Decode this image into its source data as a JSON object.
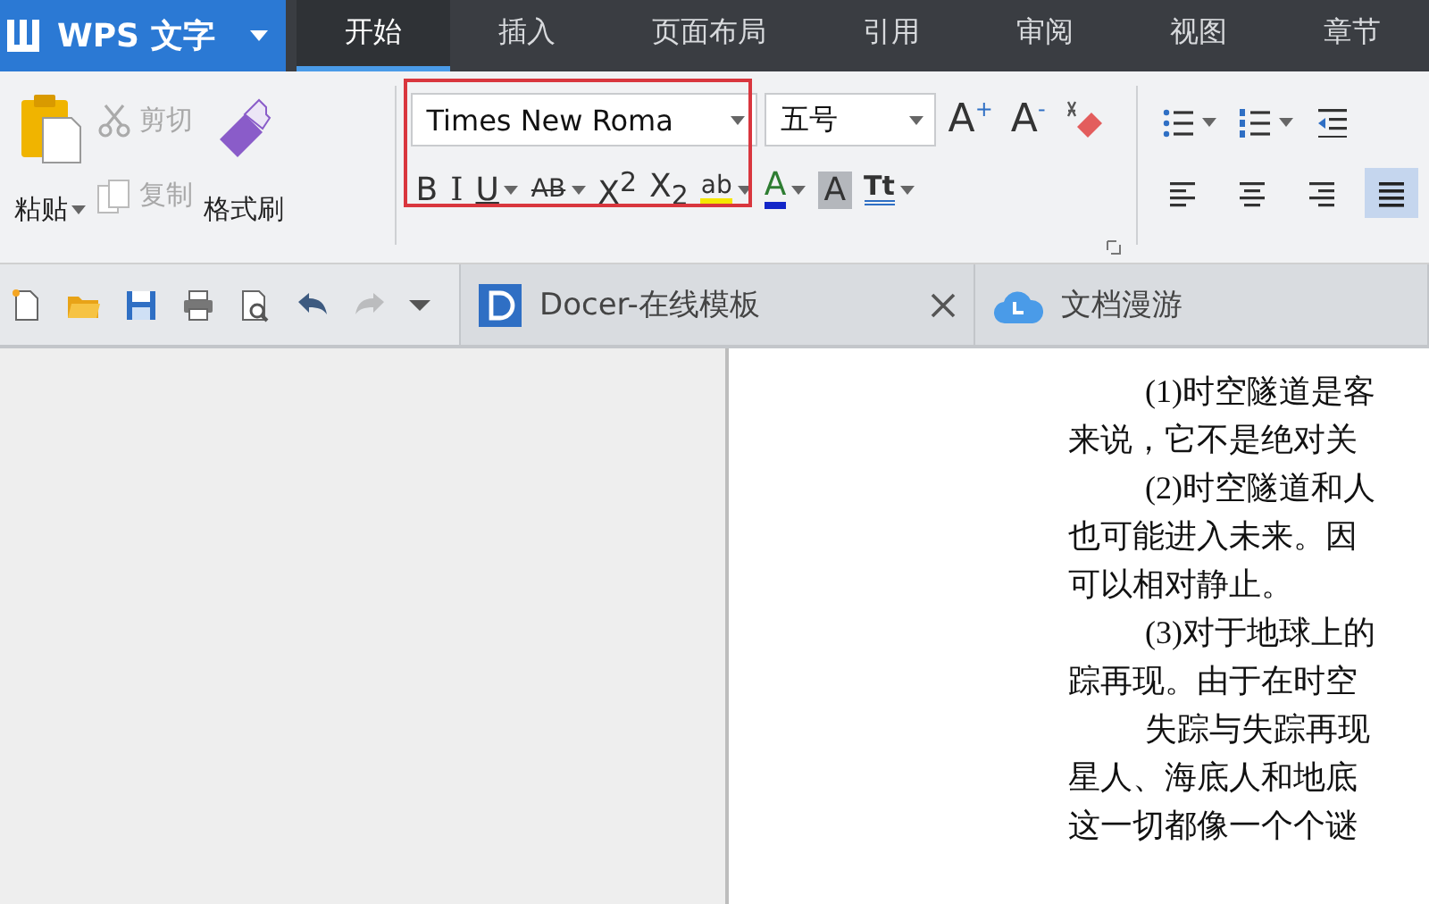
{
  "app_menu": {
    "title": "WPS 文字"
  },
  "menu_tabs": [
    {
      "label": "开始",
      "selected": true
    },
    {
      "label": "插入",
      "selected": false
    },
    {
      "label": "页面布局",
      "selected": false
    },
    {
      "label": "引用",
      "selected": false
    },
    {
      "label": "审阅",
      "selected": false
    },
    {
      "label": "视图",
      "selected": false
    },
    {
      "label": "章节",
      "selected": false
    }
  ],
  "clipboard": {
    "paste": "粘贴",
    "cut": {
      "label": "剪切",
      "disabled": true
    },
    "copy": {
      "label": "复制",
      "disabled": true
    },
    "format_painter": "格式刷"
  },
  "font": {
    "name": "Times New Roma",
    "size": "五号",
    "annotated": true,
    "row1": [
      {
        "kind": "grow",
        "label": "A$^{+}$"
      },
      {
        "kind": "shrink",
        "label": "A$^{-}$"
      },
      {
        "kind": "clear"
      }
    ],
    "row2": [
      {
        "kind": "bold",
        "label": "B",
        "dropdown": false
      },
      {
        "kind": "italic",
        "label": "I",
        "dropdown": false
      },
      {
        "kind": "underline",
        "label": "U",
        "dropdown": true
      },
      {
        "kind": "strike",
        "label": "AB",
        "dropdown": true
      },
      {
        "kind": "script",
        "label": "X$^{2}$",
        "dropdown": false
      },
      {
        "kind": "script",
        "label": "X$_{2}$",
        "dropdown": false
      },
      {
        "kind": "highlight",
        "label": "ab",
        "dropdown": true
      },
      {
        "kind": "font_color",
        "label": "A",
        "dropdown": true
      },
      {
        "kind": "shading",
        "label": "A",
        "dropdown": false
      },
      {
        "kind": "spacing",
        "label": "Tt",
        "dropdown": true
      }
    ]
  },
  "paragraph": {
    "row1": [
      {
        "kind": "bullets",
        "dropdown": true
      },
      {
        "kind": "numbering",
        "dropdown": true
      },
      {
        "kind": "outdent",
        "dropdown": false
      }
    ],
    "align": [
      {
        "kind": "left",
        "selected": false
      },
      {
        "kind": "center",
        "selected": false
      },
      {
        "kind": "right",
        "selected": false
      },
      {
        "kind": "justify",
        "selected": true
      }
    ]
  },
  "quick_access": [
    {
      "kind": "new",
      "disabled": false
    },
    {
      "kind": "open",
      "disabled": false
    },
    {
      "kind": "save",
      "disabled": false
    },
    {
      "kind": "print",
      "disabled": false
    },
    {
      "kind": "preview",
      "disabled": false
    },
    {
      "kind": "undo",
      "disabled": false
    },
    {
      "kind": "redo",
      "disabled": true
    },
    {
      "kind": "more",
      "disabled": false
    }
  ],
  "doc_tabs": [
    {
      "kind": "docer",
      "label": "Docer-在线模板",
      "closable": true
    },
    {
      "kind": "cloud",
      "label": "文档漫游",
      "closable": false
    }
  ],
  "document_lines": [
    {
      "text": "(1)时空隧道是客",
      "indent": true
    },
    {
      "text": "来说，它不是绝对关",
      "indent": false
    },
    {
      "text": "(2)时空隧道和人",
      "indent": true
    },
    {
      "text": "也可能进入未来。因",
      "indent": false
    },
    {
      "text": "可以相对静止。",
      "indent": false
    },
    {
      "text": "(3)对于地球上的",
      "indent": true
    },
    {
      "text": "踪再现。由于在时空",
      "indent": false
    },
    {
      "text": "失踪与失踪再现",
      "indent": true
    },
    {
      "text": "星人、海底人和地底",
      "indent": false
    },
    {
      "text": "这一切都像一个个谜",
      "indent": false
    }
  ]
}
